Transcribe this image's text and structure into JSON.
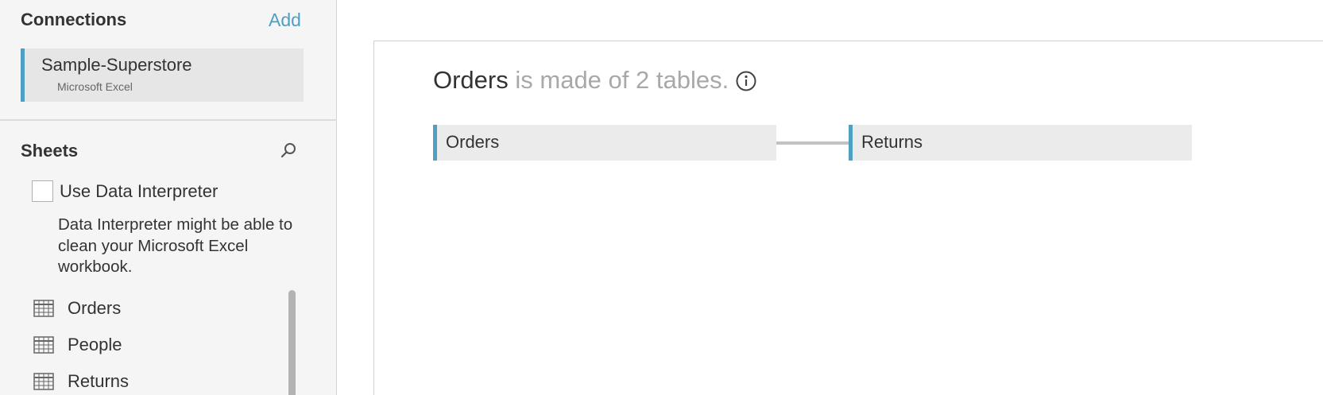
{
  "connections": {
    "title": "Connections",
    "add_label": "Add",
    "items": [
      {
        "name": "Sample-Superstore",
        "type": "Microsoft Excel"
      }
    ]
  },
  "sheets": {
    "title": "Sheets",
    "search_icon": "search-icon",
    "data_interpreter": {
      "label": "Use Data Interpreter",
      "checked": false,
      "description": "Data Interpreter might be able to clean your Microsoft Excel workbook."
    },
    "items": [
      {
        "label": "Orders",
        "icon": "table-icon"
      },
      {
        "label": "People",
        "icon": "table-icon"
      },
      {
        "label": "Returns",
        "icon": "table-icon"
      }
    ]
  },
  "canvas": {
    "heading": {
      "table_name": "Orders",
      "suffix": "is made of 2 tables."
    },
    "info_icon": "info-icon",
    "tables": [
      {
        "label": "Orders"
      },
      {
        "label": "Returns"
      }
    ]
  },
  "colors": {
    "accent": "#4f9fc2",
    "panel_bg": "#f5f5f5",
    "card_bg": "#ebebeb",
    "heading_light": "#a8a8a8",
    "link_line": "#c2c2c2"
  }
}
